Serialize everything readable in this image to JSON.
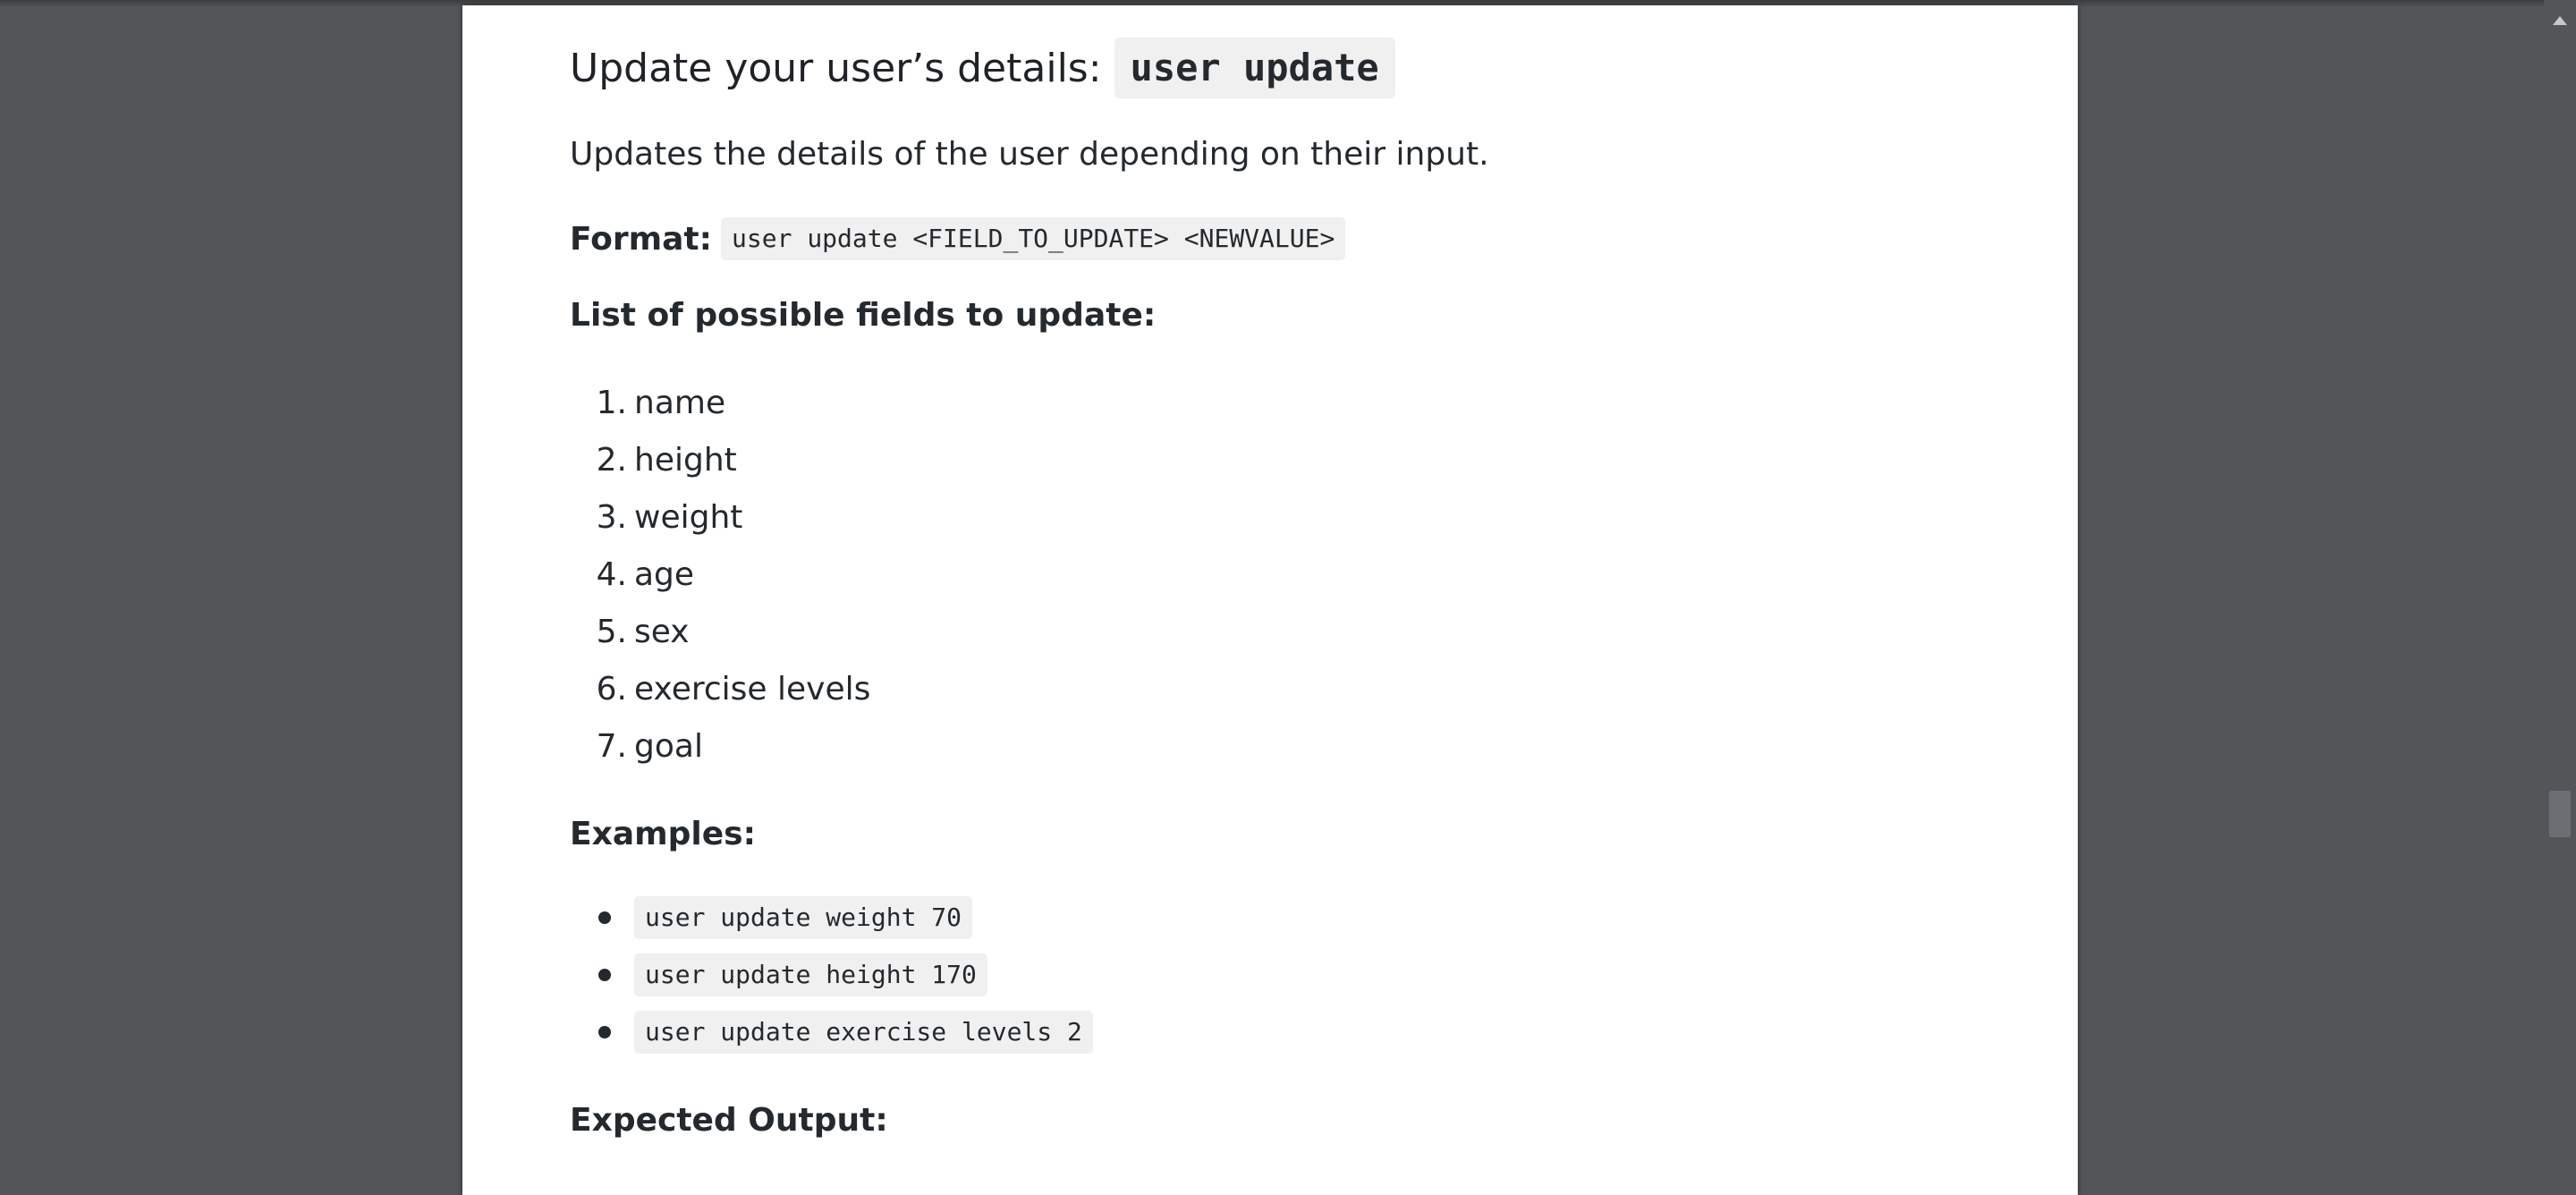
{
  "section": {
    "heading_text": "Update your user’s details:",
    "heading_code": "user update",
    "description": "Updates the details of the user depending on their input.",
    "format_label": "Format:",
    "format_code": "user update <FIELD_TO_UPDATE> <NEWVALUE>",
    "list_title": "List of possible fields to update:",
    "fields": [
      {
        "num": "1.",
        "label": "name"
      },
      {
        "num": "2.",
        "label": "height"
      },
      {
        "num": "3.",
        "label": "weight"
      },
      {
        "num": "4.",
        "label": "age"
      },
      {
        "num": "5.",
        "label": "sex"
      },
      {
        "num": "6.",
        "label": "exercise levels"
      },
      {
        "num": "7.",
        "label": "goal"
      }
    ],
    "examples_title": "Examples:",
    "examples": [
      "user update weight 70",
      "user update height 170",
      "user update exercise levels 2"
    ],
    "expected_title": "Expected Output:"
  },
  "icons": {
    "scroll_up": "chevron-up-icon"
  },
  "colors": {
    "viewer_background": "#525659",
    "page_background": "#ffffff",
    "code_background": "#f0f0f0",
    "text": "#24292e"
  }
}
